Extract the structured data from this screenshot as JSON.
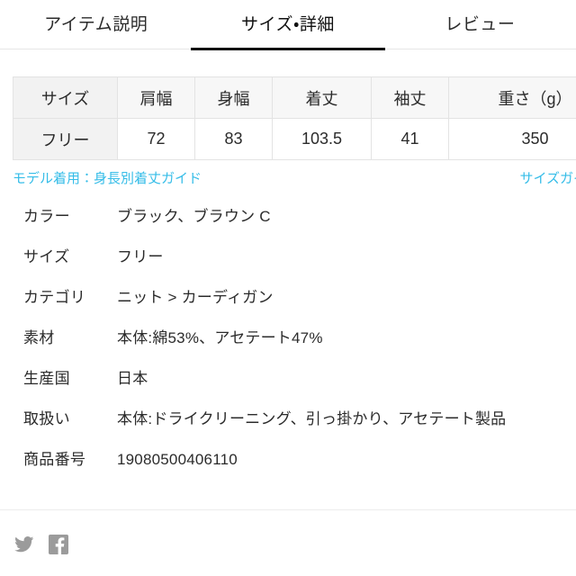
{
  "tabs": [
    {
      "label": "アイテム説明",
      "active": false
    },
    {
      "label": "サイズ・詳細",
      "active": true
    },
    {
      "label": "レビュー",
      "active": false
    }
  ],
  "size_table": {
    "headers": [
      "サイズ",
      "肩幅",
      "身幅",
      "着丈",
      "袖丈",
      "重さ（g）"
    ],
    "rows": [
      [
        "フリー",
        "72",
        "83",
        "103.5",
        "41",
        "350"
      ]
    ]
  },
  "guide_links": {
    "left": "モデル着用：身長別着丈ガイド",
    "right": "サイズガイ",
    "color": "#36bde8"
  },
  "details": [
    {
      "label": "カラー",
      "value": "ブラック、ブラウン C"
    },
    {
      "label": "サイズ",
      "value": "フリー"
    },
    {
      "label": "カテゴリ",
      "value": "ニット > カーディガン"
    },
    {
      "label": "素材",
      "value": "本体:綿53%、アセテート47%"
    },
    {
      "label": "生産国",
      "value": "日本"
    },
    {
      "label": "取扱い",
      "value": "本体:ドライクリーニング、引っ掛かり、アセテート製品"
    },
    {
      "label": "商品番号",
      "value": "19080500406110"
    }
  ],
  "footer": {
    "social": [
      {
        "name": "twitter-icon",
        "color": "#9b9b9b"
      },
      {
        "name": "facebook-icon",
        "color": "#9b9b9b"
      }
    ]
  }
}
